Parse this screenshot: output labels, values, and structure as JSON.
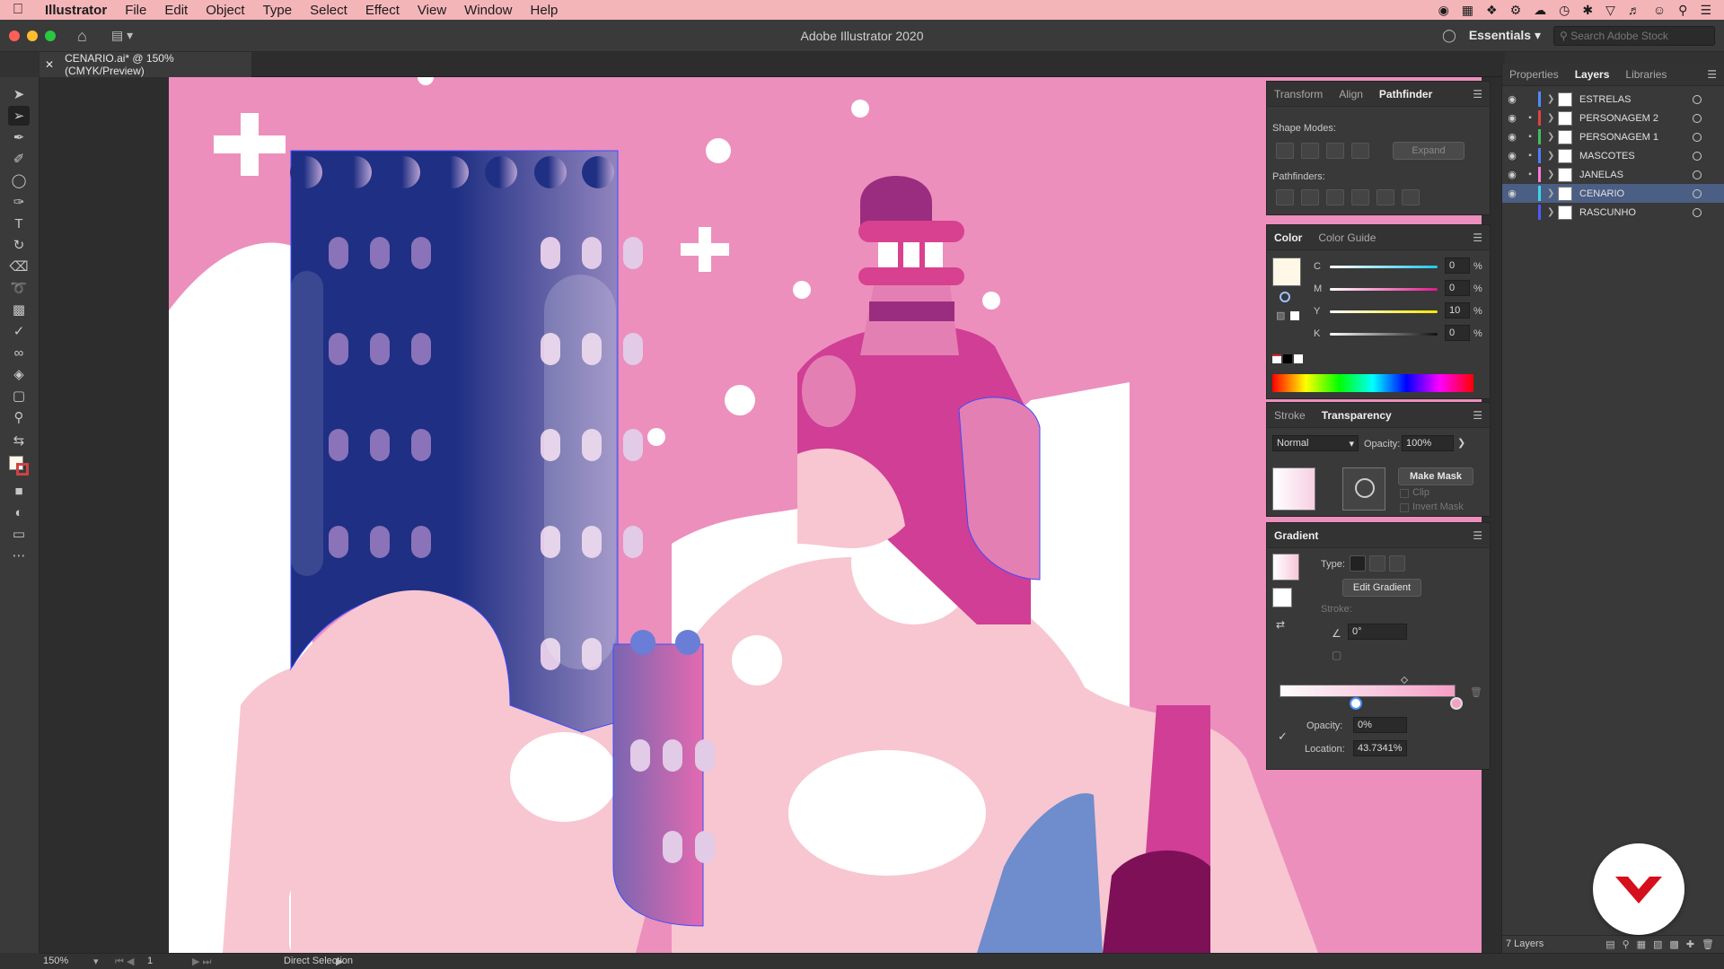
{
  "menubar": {
    "app_name": "Illustrator",
    "items": [
      "File",
      "Edit",
      "Object",
      "Type",
      "Select",
      "Effect",
      "View",
      "Window",
      "Help"
    ]
  },
  "window": {
    "title": "Adobe Illustrator 2020",
    "workspace": "Essentials",
    "stock_search_placeholder": "Search Adobe Stock"
  },
  "document_tab": {
    "label": "CENARIO.ai* @ 150% (CMYK/Preview)"
  },
  "pathfinder_panel": {
    "tabs": [
      "Transform",
      "Align",
      "Pathfinder"
    ],
    "active_tab": "Pathfinder",
    "shape_modes_label": "Shape Modes:",
    "expand_label": "Expand",
    "pathfinders_label": "Pathfinders:"
  },
  "color_panel": {
    "tabs": [
      "Color",
      "Color Guide"
    ],
    "channels": [
      {
        "label": "C",
        "value": "0",
        "unit": "%"
      },
      {
        "label": "M",
        "value": "0",
        "unit": "%"
      },
      {
        "label": "Y",
        "value": "10",
        "unit": "%"
      },
      {
        "label": "K",
        "value": "0",
        "unit": "%"
      }
    ]
  },
  "transparency_panel": {
    "tabs": [
      "Stroke",
      "Transparency"
    ],
    "blend_mode": "Normal",
    "opacity_label": "Opacity:",
    "opacity_value": "100%",
    "make_mask_label": "Make Mask",
    "clip_label": "Clip",
    "invert_mask_label": "Invert Mask"
  },
  "gradient_panel": {
    "title": "Gradient",
    "type_label": "Type:",
    "edit_gradient_label": "Edit Gradient",
    "stroke_label": "Stroke:",
    "angle_value": "0°",
    "opacity_label": "Opacity:",
    "opacity_value": "0%",
    "location_label": "Location:",
    "location_value": "43.7341%"
  },
  "layers_panel": {
    "tabs": [
      "Properties",
      "Layers",
      "Libraries"
    ],
    "active_tab": "Layers",
    "layers": [
      {
        "name": "ESTRELAS",
        "locked": false,
        "color": "#4f8bff"
      },
      {
        "name": "PERSONAGEM 2",
        "locked": true,
        "color": "#e04343"
      },
      {
        "name": "PERSONAGEM 1",
        "locked": true,
        "color": "#3fbf5f"
      },
      {
        "name": "MASCOTES",
        "locked": true,
        "color": "#4f7dff"
      },
      {
        "name": "JANELAS",
        "locked": true,
        "color": "#ff7ad9"
      },
      {
        "name": "CENARIO",
        "locked": false,
        "color": "#3fd6e6",
        "selected": true
      },
      {
        "name": "RASCUNHO",
        "locked": false,
        "color": "#4f59ff",
        "hidden": true
      }
    ],
    "footer": "7 Layers"
  },
  "statusbar": {
    "zoom": "150%",
    "artboard": "1",
    "tool": "Direct Selection"
  }
}
